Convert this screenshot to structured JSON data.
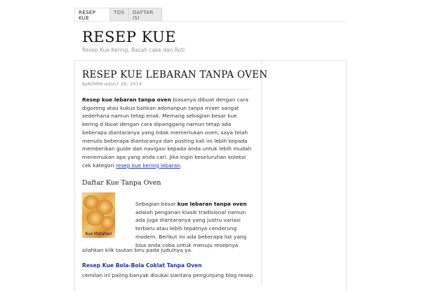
{
  "nav": {
    "tabs": [
      {
        "label": "RESEP KUE"
      },
      {
        "label": "TOS"
      },
      {
        "label": "DAFTAR ISI"
      }
    ]
  },
  "site": {
    "title": "RESEP KUE",
    "tagline": "Resep Kue Kering, Basah cake dan Roti"
  },
  "post": {
    "title": "RESEP KUE LEBARAN TANPA OVEN",
    "meta_by": "by",
    "meta_author": "ADMIN",
    "meta_on": "on",
    "meta_date": "JULY 26, 2014",
    "intro_bold": "Resep kue lebaran tanpa oven",
    "intro_text": " biasanya dibuat dengan cara digoreng atau kukus bahkan adonanpun tanpa mixer sangat sederhana namun tetap enak.  Memang sebagian besar kue kering d ibuat dengan cara dipanggang namun tetap ada beberapa diantaranya yang tidak memerlukan oven, saya telah menulis beberapa diantaranya dan posting kali ini lebih kepada memberikan guide dan navigasi kepada anda untuk lebih mudah menemukan apa yang anda cari. Jika ingin keseluruhan koleksi cek kategori ",
    "intro_link": "resep kue kering lebaran",
    "intro_end": ".",
    "section_heading": "Daftar Kue Tanpa Oven",
    "image_caption": "Kue Matahari",
    "p2_a": "Sebagian besar ",
    "p2_bold": "kue lebaran tanpa oven",
    "p2_b": " adalah penganan klasik tradisional namun ada juga diantaranya yang justru variasi terbaru atau lebih tepatnya cenderung modern. Berikut ini ada beberapa list yang bisa anda coba untuk menuju resepnya",
    "p2_c": "silahkan klik tautan biru pada judulnya ya.",
    "recipe_link": "Resep Kue Bola-Bola Coklat Tanpa Oven",
    "p3": "cemilan ini paling banyak disukai siantara pengunjung blog resep"
  }
}
